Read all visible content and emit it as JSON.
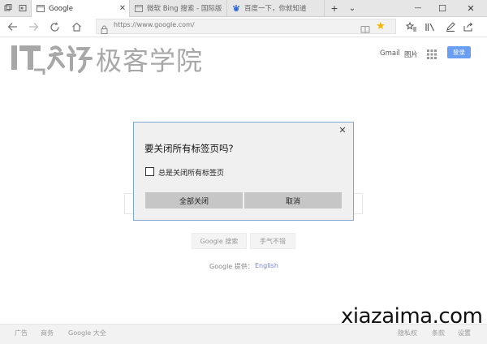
{
  "tabs": [
    {
      "title": "Google",
      "active": true
    },
    {
      "title": "微软 Bing 搜索 - 国际版",
      "active": false
    },
    {
      "title": "百度一下，你就知道",
      "active": false
    }
  ],
  "window_controls": {
    "new_tab": "+",
    "tab_list": "⌄",
    "minimize": "—",
    "maximize": "☐",
    "close": "✕"
  },
  "address_bar": {
    "url": "https://www.google.com/"
  },
  "watermark_logo": {
    "latin": "IT",
    "cjk": "极客学院"
  },
  "google": {
    "links": {
      "gmail": "Gmail",
      "images": "图片"
    },
    "sign_in": "登录",
    "search_button": "Google 搜索",
    "lucky_button": "手气不错",
    "offered_in": "Google 提供：",
    "language": "English",
    "footer_left": [
      "广告",
      "商务",
      "Google 大全"
    ],
    "footer_right": [
      "隐私权",
      "条款",
      "设置"
    ]
  },
  "site_watermark": "xiazaima.com",
  "dialog": {
    "close": "✕",
    "title": "要关闭所有标签页吗?",
    "checkbox_label": "总是关闭所有标签页",
    "checkbox_checked": false,
    "confirm_label": "全部关闭",
    "cancel_label": "取消"
  },
  "colors": {
    "sign_in": "#6a9ef3",
    "dialog_border": "#7fa7cf",
    "button": "#c6c6c6"
  }
}
